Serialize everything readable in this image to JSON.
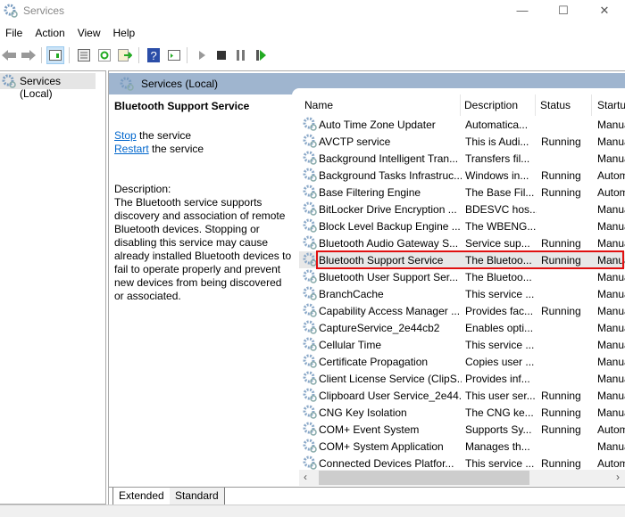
{
  "window": {
    "title": "Services",
    "min": "—",
    "max": "☐",
    "close": "✕"
  },
  "menu": [
    "File",
    "Action",
    "View",
    "Help"
  ],
  "tree": {
    "item": "Services (Local)"
  },
  "pane": {
    "header": "Services (Local)"
  },
  "details": {
    "title": "Bluetooth Support Service",
    "stop_link": "Stop",
    "stop_rest": " the service",
    "restart_link": "Restart",
    "restart_rest": " the service",
    "desc_label": "Description:",
    "description": "The Bluetooth service supports discovery and association of remote Bluetooth devices.  Stopping or disabling this service may cause already installed Bluetooth devices to fail to operate properly and prevent new devices from being discovered or associated."
  },
  "columns": {
    "name": "Name",
    "description": "Description",
    "status": "Status",
    "startup": "Startup Type"
  },
  "rows": [
    {
      "name": "Auto Time Zone Updater",
      "desc": "Automatica...",
      "status": "",
      "startup": "Manual"
    },
    {
      "name": "AVCTP service",
      "desc": "This is Audi...",
      "status": "Running",
      "startup": "Manual"
    },
    {
      "name": "Background Intelligent Tran...",
      "desc": "Transfers fil...",
      "status": "",
      "startup": "Manual"
    },
    {
      "name": "Background Tasks Infrastruc...",
      "desc": "Windows in...",
      "status": "Running",
      "startup": "Automatic"
    },
    {
      "name": "Base Filtering Engine",
      "desc": "The Base Fil...",
      "status": "Running",
      "startup": "Automatic"
    },
    {
      "name": "BitLocker Drive Encryption ...",
      "desc": "BDESVC hos...",
      "status": "",
      "startup": "Manual"
    },
    {
      "name": "Block Level Backup Engine ...",
      "desc": "The WBENG...",
      "status": "",
      "startup": "Manual"
    },
    {
      "name": "Bluetooth Audio Gateway S...",
      "desc": "Service sup...",
      "status": "Running",
      "startup": "Manual"
    },
    {
      "name": "Bluetooth Support Service",
      "desc": "The Bluetoo...",
      "status": "Running",
      "startup": "Manual"
    },
    {
      "name": "Bluetooth User Support Ser...",
      "desc": "The Bluetoo...",
      "status": "",
      "startup": "Manual"
    },
    {
      "name": "BranchCache",
      "desc": "This service ...",
      "status": "",
      "startup": "Manual"
    },
    {
      "name": "Capability Access Manager ...",
      "desc": "Provides fac...",
      "status": "Running",
      "startup": "Manual"
    },
    {
      "name": "CaptureService_2e44cb2",
      "desc": "Enables opti...",
      "status": "",
      "startup": "Manual"
    },
    {
      "name": "Cellular Time",
      "desc": "This service ...",
      "status": "",
      "startup": "Manual"
    },
    {
      "name": "Certificate Propagation",
      "desc": "Copies user ...",
      "status": "",
      "startup": "Manual"
    },
    {
      "name": "Client License Service (ClipS...",
      "desc": "Provides inf...",
      "status": "",
      "startup": "Manual"
    },
    {
      "name": "Clipboard User Service_2e44...",
      "desc": "This user ser...",
      "status": "Running",
      "startup": "Manual"
    },
    {
      "name": "CNG Key Isolation",
      "desc": "The CNG ke...",
      "status": "Running",
      "startup": "Manual"
    },
    {
      "name": "COM+ Event System",
      "desc": "Supports Sy...",
      "status": "Running",
      "startup": "Automatic"
    },
    {
      "name": "COM+ System Application",
      "desc": "Manages th...",
      "status": "",
      "startup": "Manual"
    },
    {
      "name": "Connected Devices Platfor...",
      "desc": "This service ...",
      "status": "Running",
      "startup": "Automatic"
    }
  ],
  "selected_index": 8,
  "tabs": [
    "Extended",
    "Standard"
  ],
  "colors": {
    "header_band": "#9fb5cf",
    "highlight": "#e01010",
    "link": "#0066cc"
  }
}
